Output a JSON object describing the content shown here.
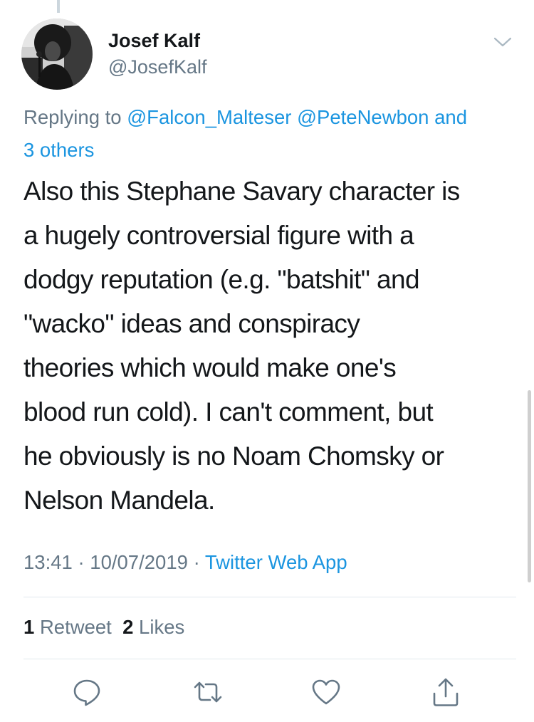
{
  "author": {
    "name": "Josef Kalf",
    "handle": "@JosefKalf"
  },
  "reply": {
    "prefix": "Replying to",
    "mention1": "@Falcon_Malteser",
    "mention2": "@PeteNewbon",
    "connector": "and",
    "others": "3 others"
  },
  "tweet": {
    "lines": [
      "Also this Stephane Savary character is",
      "a hugely controversial figure with a",
      "dodgy reputation (e.g. \"batshit\" and",
      "\"wacko\" ideas and conspiracy",
      "theories which would make one's",
      "blood run cold). I can't comment, but",
      "he obviously is no Noam Chomsky or",
      "Nelson Mandela."
    ]
  },
  "meta": {
    "time": "13:41",
    "date": "10/07/2019",
    "separator": "·",
    "source": "Twitter Web App"
  },
  "stats": {
    "retweets_count": "1",
    "retweets_label": "Retweet",
    "likes_count": "2",
    "likes_label": "Likes"
  },
  "icons": {
    "reply": "reply-icon",
    "retweet": "retweet-icon",
    "like": "heart-icon",
    "share": "share-icon",
    "menu": "chevron-down-icon"
  },
  "colors": {
    "link": "#1b95e0",
    "secondary_text": "#657786",
    "primary_text": "#14171a",
    "divider": "#e1e8ed"
  }
}
